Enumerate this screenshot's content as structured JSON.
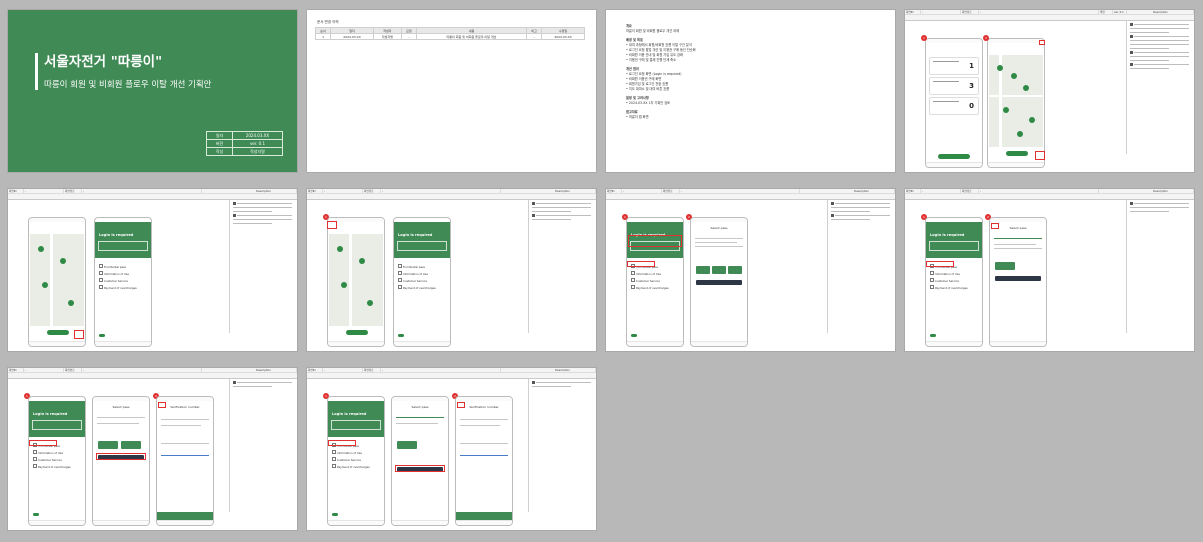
{
  "slides": {
    "title": {
      "main": "서울자전거 \"따릉이\"",
      "sub": "따릉이 회원 및 비회원 플로우 이탈 개선 기획안",
      "meta": [
        {
          "key": "일자",
          "value": "2024.03.XX"
        },
        {
          "key": "버전",
          "value": "ver. 0.1"
        },
        {
          "key": "작성",
          "value": "작성자명"
        }
      ]
    },
    "history": {
      "title": "문서 변경 이력",
      "headers": [
        "순서",
        "일자",
        "작성자",
        "요청",
        "내용",
        "비고",
        "수정일"
      ],
      "rows": [
        [
          "1",
          "2024.03.XX",
          "작성자명",
          "-",
          "따릉이 회원 및 비회원 플로우 이탈 개선",
          "-",
          "2024.03.XX"
        ]
      ]
    },
    "overview": {
      "lines": [
        {
          "h": true,
          "t": "개요"
        },
        {
          "h": false,
          "t": "따릉이 회원 및 비회원 플로우 개선 과제"
        },
        {
          "h": true,
          "t": "배경 및 목표"
        },
        {
          "h": false,
          "t": "• 대여 과정에서 회원/비회원 흐름 이탈 구간 분석"
        },
        {
          "h": false,
          "t": "• 로그인 요청 팝업 개선 및 이용권 구매 동선 단순화"
        },
        {
          "h": false,
          "t": "• 비회원 이용 안내 및 회원 가입 유도 강화"
        },
        {
          "h": false,
          "t": "• 이용권 구매 및 결제 진행 단계 축소"
        },
        {
          "h": true,
          "t": "개선 범위"
        },
        {
          "h": false,
          "t": "• 로그인 요청 화면 (Login is required)"
        },
        {
          "h": false,
          "t": "• 비회원 이용권 구매 화면"
        },
        {
          "h": false,
          "t": "• 회원가입 및 로그인 전환 흐름"
        },
        {
          "h": false,
          "t": "• 지도 대여소 및 대여 버튼 흐름"
        },
        {
          "h": true,
          "t": "일정 및 고려사항"
        },
        {
          "h": false,
          "t": "• 2024.03.XX 1차 기획안 검토"
        },
        {
          "h": true,
          "t": "참고자료"
        },
        {
          "h": false,
          "t": "• 따릉이 앱 화면"
        }
      ]
    },
    "flow_header": {
      "page_label": "화면ID",
      "page_value": "-",
      "route_label": "화면경로",
      "route_value": "-",
      "desc_title": "Description",
      "version_label": "버전",
      "version_value": "ver. 0.1"
    },
    "flow": {
      "login_title": "Login is required",
      "menu": [
        "Find Rental pass",
        "Information of Use",
        "Customer Service",
        "Payment of overcharges"
      ],
      "pass_title": "Select pass",
      "signup_title": "Verification number",
      "rental_numbers": [
        "1",
        "3",
        "0"
      ],
      "badges": [
        "1",
        "2"
      ]
    }
  }
}
